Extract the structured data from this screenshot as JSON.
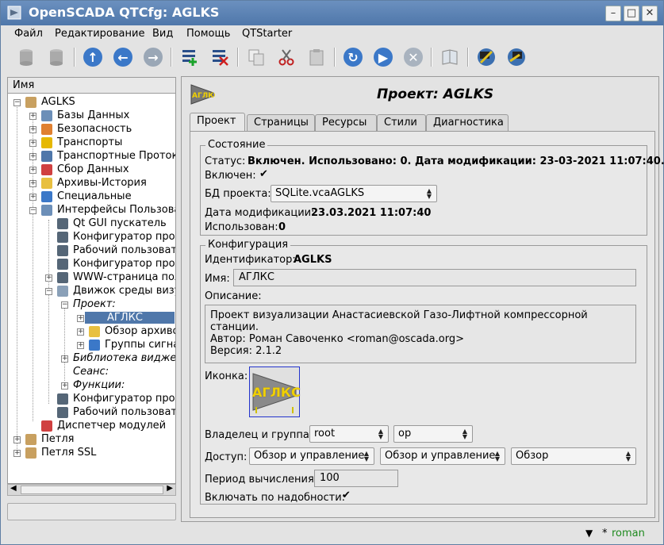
{
  "window": {
    "title": "OpenSCADA QTCfg: AGLKS"
  },
  "menu": [
    "Файл",
    "Редактирование",
    "Вид",
    "Помощь",
    "QTStarter"
  ],
  "tree": {
    "header": "Имя",
    "nodes": [
      "AGLKS",
      "Базы Данных",
      "Безопасность",
      "Транспорты",
      "Транспортные Протоколы",
      "Сбор Данных",
      "Архивы-История",
      "Специальные",
      "Интерфейсы Пользователя",
      "Qt GUI пускатель",
      "Конфигуратор программы",
      "Рабочий пользователь",
      "Конфигуратор программы",
      "WWW-страница пользователя",
      "Движок среды визуализации",
      "Проект:",
      "АГЛКС",
      "Обзор архивов",
      "Группы сигнализации",
      "Библиотека виджетов:",
      "Сеанс:",
      "Функции:",
      "Конфигуратор программы",
      "Рабочий пользователь",
      "Диспетчер модулей",
      "Петля",
      "Петля SSL"
    ]
  },
  "page": {
    "icon_text": "АГЛКС",
    "title": "Проект: AGLKS",
    "tabs": [
      "Проект",
      "Страницы",
      "Ресурсы",
      "Стили",
      "Диагностика"
    ],
    "state": {
      "group_title": "Состояние",
      "status_label": "Статус:",
      "status_value": "Включен. Использовано: 0. Дата модификации: 23-03-2021 11:07:40.",
      "enabled_label": "Включен:",
      "db_label": "БД проекта:",
      "db_value": "SQLite.vcaAGLKS",
      "mod_label": "Дата модификации:",
      "mod_value": "23.03.2021 11:07:40",
      "used_label": "Использован:",
      "used_value": "0"
    },
    "config": {
      "group_title": "Конфигурация",
      "id_label": "Идентификатор:",
      "id_value": "AGLKS",
      "name_label": "Имя:",
      "name_value": "АГЛКС",
      "desc_label": "Описание:",
      "desc_line1": "Проект визуализации Анастасиевской Газо-Лифтной компрессорной станции.",
      "desc_line2": "Автор: Роман Савоченко <roman@oscada.org>",
      "desc_line3": "Версия: 2.1.2",
      "icon_label": "Иконка:",
      "owner_label": "Владелец и группа:",
      "owner_value": "root",
      "group_value": "op",
      "access_label": "Доступ:",
      "access_owner": "Обзор и управление",
      "access_group": "Обзор и управление",
      "access_other": "Обзор",
      "period_label": "Период вычисления:",
      "period_value": "100",
      "ondemand_label": "Включать по надобности:"
    }
  },
  "statusbar": {
    "user": "roman",
    "mark": "*"
  }
}
